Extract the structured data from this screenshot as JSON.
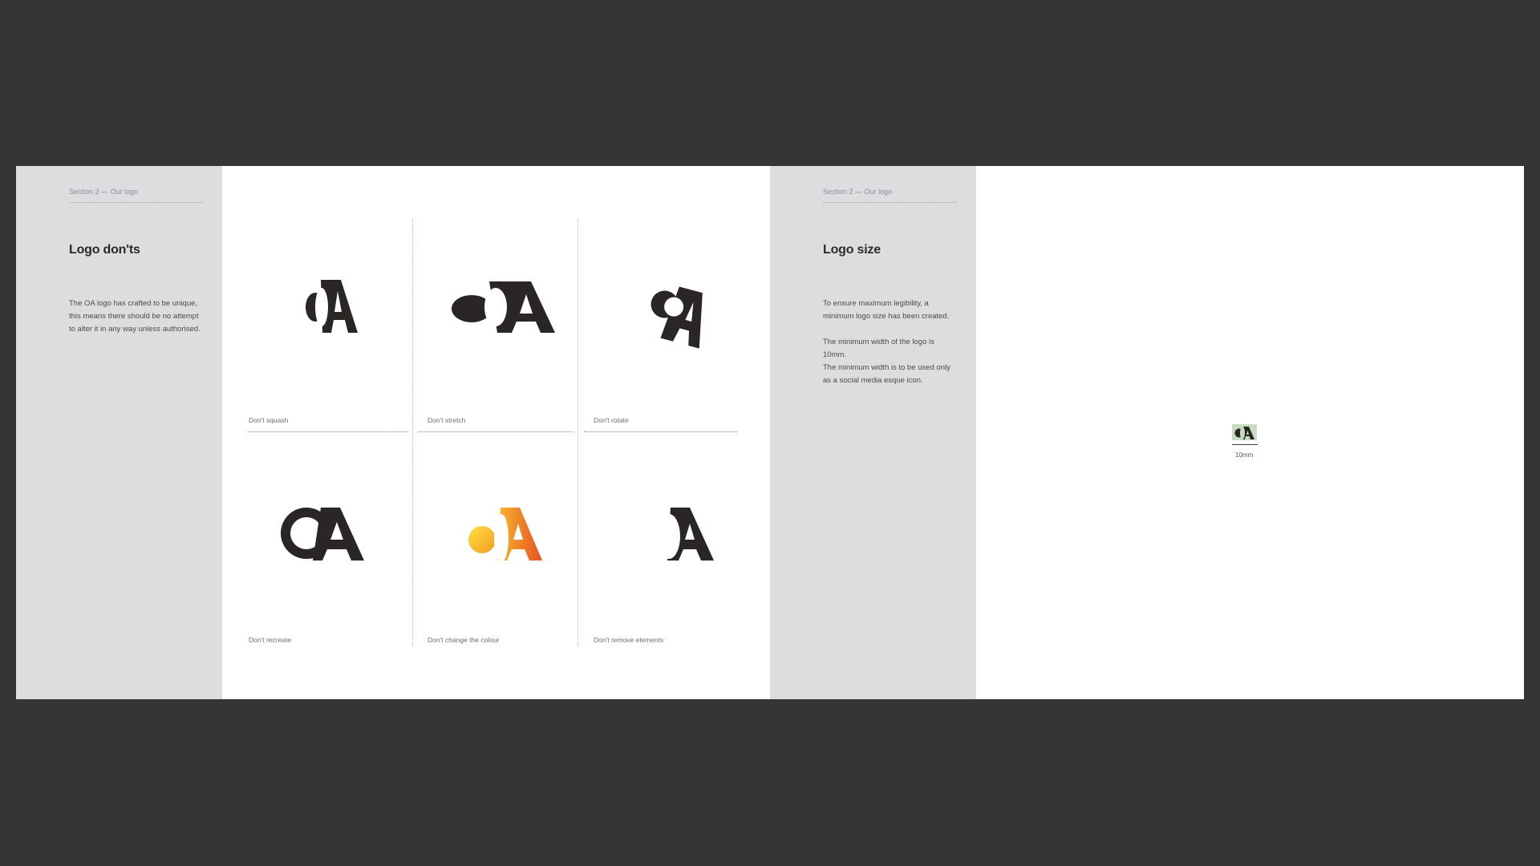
{
  "left_page": {
    "section_label": "Section 2 — Our logo",
    "title": "Logo don'ts",
    "paragraph": "The OA logo has crafted to be unique, this means there should be no attempt to alter it in any way unless authorised.",
    "captions": [
      "Don't squash",
      "Don't stretch",
      "Don't rotate",
      "Don't recreate",
      "Don't change the colour",
      "Don't remove elements"
    ]
  },
  "right_page": {
    "section_label": "Section 2 — Our logo",
    "title": "Logo size",
    "paragraphs": [
      "To ensure maximum legibility, a minimum logo size has been created.",
      "The minimum width of the logo is 10mm.",
      "The minimum width is to be used only as a social media esque icon."
    ],
    "min_size_label": "10mm"
  },
  "colors": {
    "background": "#353535",
    "sidebar": "#dcdddf",
    "logo": "#2a2625",
    "gradient_start": "#f5b82e",
    "gradient_end": "#e8521f",
    "min_box": "#c7dcc0"
  }
}
